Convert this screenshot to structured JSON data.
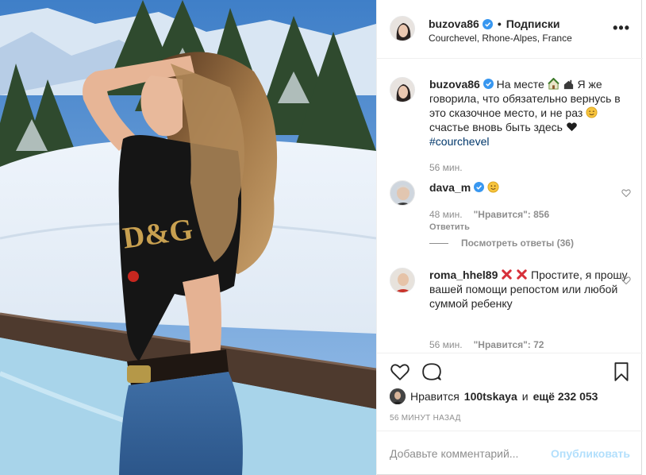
{
  "header": {
    "username": "buzova86",
    "separator": "•",
    "follow_label": "Подписки",
    "location": "Courchevel, Rhone-Alpes, France",
    "more_icon": "more-horizontal-icon"
  },
  "caption": {
    "username": "buzova86",
    "text_1": "На месте",
    "text_2": "Я же говорила, что обязательно вернусь в это сказочное место, и не раз",
    "text_3": "счастье вновь быть здесь",
    "hashtag": "#courchevel",
    "time": "56 мин."
  },
  "comments": [
    {
      "username": "dava_m",
      "time": "48 мин.",
      "likes": "\"Нравится\": 856",
      "reply_label": "Ответить",
      "view_replies": "Посмотреть ответы (36)"
    },
    {
      "username": "roma_hhel89",
      "text": "Простите, я прошу вашей помощи репостом или любой суммой ребенку",
      "time": "56 мин.",
      "likes": "\"Нравится\": 72"
    }
  ],
  "likes": {
    "prefix": "Нравится",
    "user": "100tskaya",
    "middle": "и",
    "others": "ещё 232 053"
  },
  "time_ago": "56 МИНУТ НАЗАД",
  "add_comment": {
    "placeholder": "Добавьте комментарий...",
    "publish_label": "Опубликовать"
  },
  "colors": {
    "accent_blue": "#3897f0",
    "link_blue": "#00376b",
    "muted_gray": "#8e8e8e",
    "publish_disabled": "#b2dffc"
  }
}
